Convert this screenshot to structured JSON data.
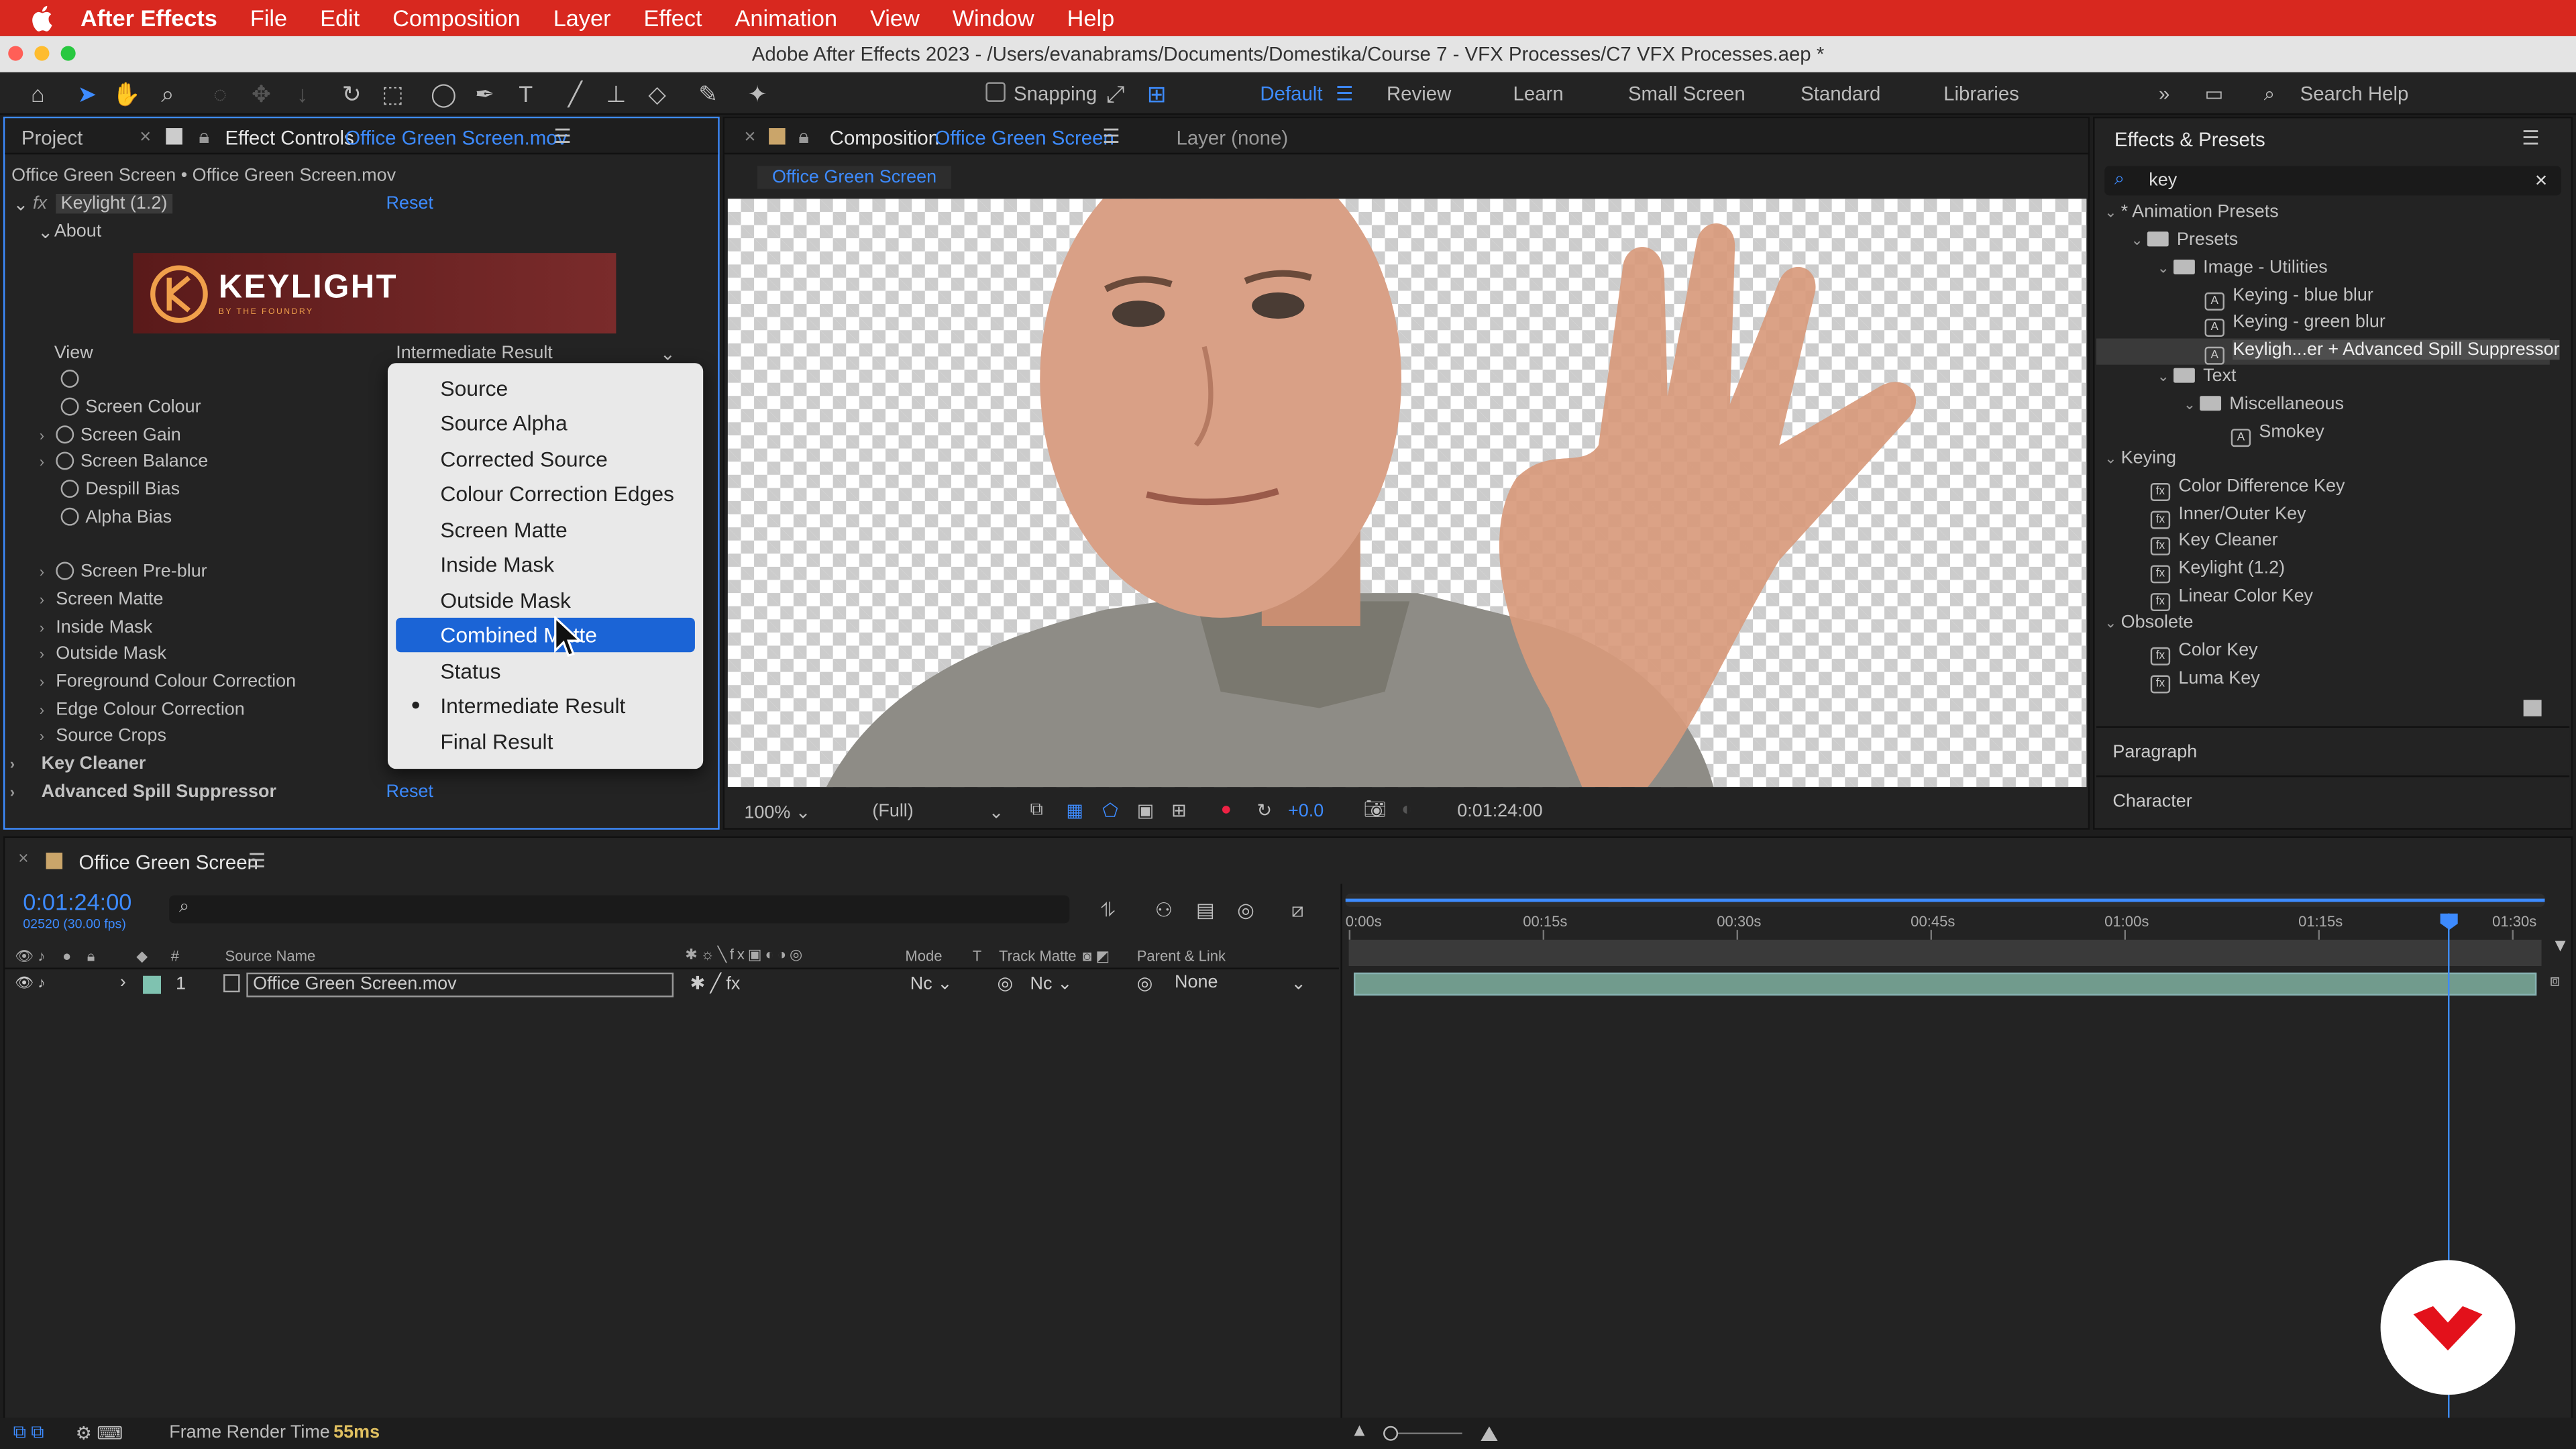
{
  "menubar": {
    "app": "After Effects",
    "items": [
      "File",
      "Edit",
      "Composition",
      "Layer",
      "Effect",
      "Animation",
      "View",
      "Window",
      "Help"
    ]
  },
  "window": {
    "title": "Adobe After Effects 2023 - /Users/evanabrams/Documents/Domestika/Course 7 - VFX Processes/C7 VFX Processes.aep *"
  },
  "toolbar": {
    "snapping": "Snapping",
    "workspaces": [
      "Default",
      "Review",
      "Learn",
      "Small Screen",
      "Standard",
      "Libraries"
    ],
    "search_placeholder": "Search Help"
  },
  "effect_controls": {
    "tab_project": "Project",
    "tab_label": "Effect Controls",
    "tab_file": "Office Green Screen.mov",
    "breadcrumb": "Office Green Screen • Office Green Screen.mov",
    "effect_name": "Keylight (1.2)",
    "reset": "Reset",
    "about": "About",
    "logo_text": "KEYLIGHT",
    "logo_sub": "BY THE FOUNDRY",
    "view_label": "View",
    "view_value": "Intermediate Result",
    "params": [
      "Screen Colour",
      "Screen Gain",
      "Screen Balance",
      "Despill Bias",
      "Alpha Bias",
      "Screen Pre-blur",
      "Screen Matte",
      "Inside Mask",
      "Outside Mask",
      "Foreground Colour Correction",
      "Edge Colour Correction",
      "Source Crops"
    ],
    "key_cleaner": "Key Cleaner",
    "spill": "Advanced Spill Suppressor",
    "spill_reset": "Reset"
  },
  "dropdown": {
    "options": [
      "Source",
      "Source Alpha",
      "Corrected Source",
      "Colour Correction Edges",
      "Screen Matte",
      "Inside Mask",
      "Outside Mask",
      "Combined Matte",
      "Status",
      "Intermediate Result",
      "Final Result"
    ],
    "selected": "Combined Matte",
    "checked": "Intermediate Result"
  },
  "composition": {
    "tab_label": "Composition",
    "tab_name": "Office Green Screen",
    "layer_label": "Layer (none)",
    "comp_chip": "Office Green Screen",
    "zoom": "100%",
    "resolution": "(Full)",
    "exposure": "+0.0",
    "timecode": "0:01:24:00"
  },
  "effects_presets": {
    "title": "Effects & Presets",
    "search": "key",
    "tree": [
      "* Animation Presets",
      "Presets",
      "Image - Utilities",
      "Keying - blue blur",
      "Keying - green blur",
      "Keyligh...er + Advanced Spill Suppressor",
      "Text",
      "Miscellaneous",
      "Smokey",
      "Keying",
      "Color Difference Key",
      "Inner/Outer Key",
      "Key Cleaner",
      "Keylight (1.2)",
      "Linear Color Key",
      "Obsolete",
      "Color Key",
      "Luma Key"
    ],
    "paragraph": "Paragraph",
    "character": "Character"
  },
  "timeline": {
    "tab": "Office Green Screen",
    "timecode": "0:01:24:00",
    "frames": "02520 (30.00 fps)",
    "col_num": "#",
    "col_source": "Source Name",
    "col_mode": "Mode",
    "col_t": "T",
    "col_matte": "Track Matte",
    "col_parent": "Parent & Link",
    "layer_num": "1",
    "layer_name": "Office Green Screen.mov",
    "layer_mode": "Nc",
    "layer_matte": "Nc",
    "layer_parent": "None",
    "ruler": [
      "0:00s",
      "00:15s",
      "00:30s",
      "00:45s",
      "01:00s",
      "01:15s",
      "01:30s"
    ],
    "playhead_fraction": 0.922
  },
  "status": {
    "label": "Frame Render Time",
    "value": "55ms"
  },
  "colors": {
    "accent": "#3d8bff",
    "menubar": "#d8281f",
    "selection": "#1b64d6"
  }
}
